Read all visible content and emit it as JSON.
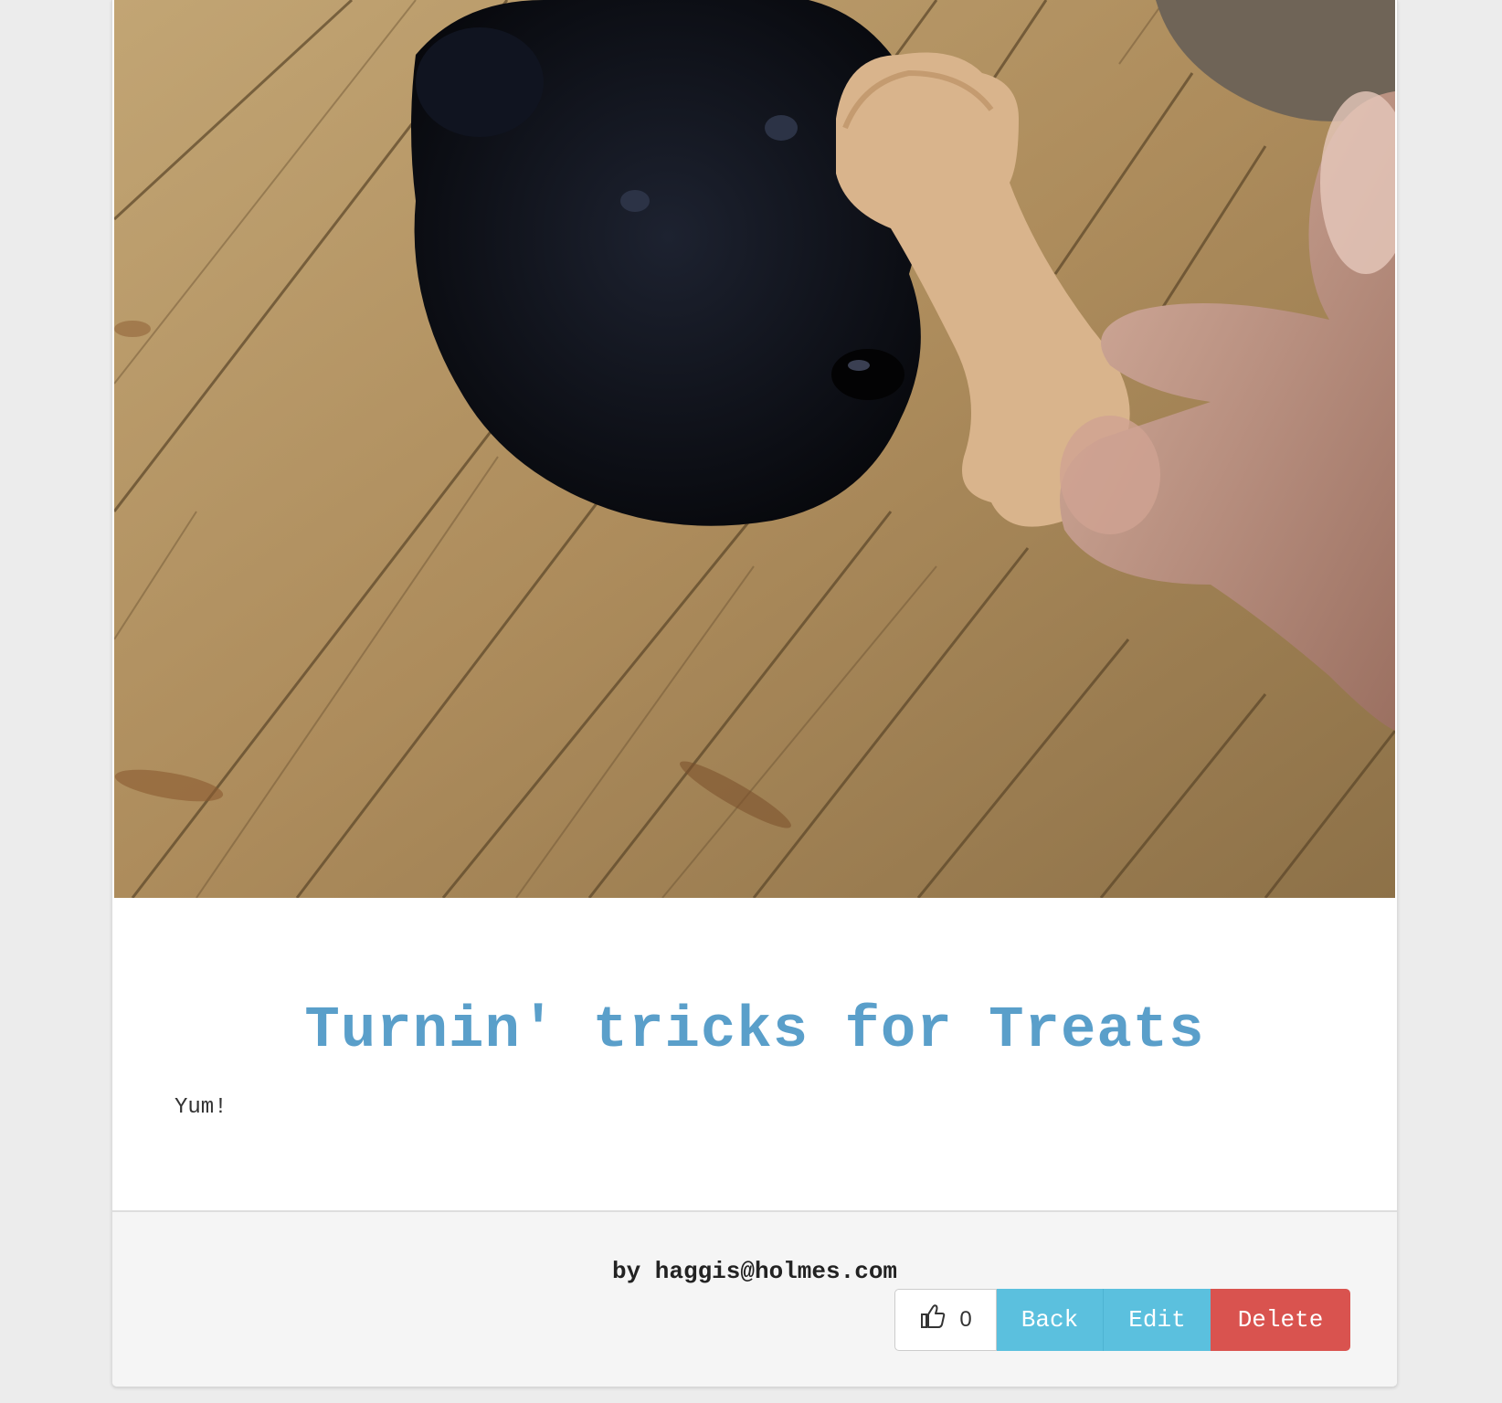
{
  "post": {
    "title": "Turnin' tricks for Treats",
    "text": "Yum!",
    "image_description": "dog-with-treat-photo"
  },
  "footer": {
    "byline": "by haggis@holmes.com",
    "like_count": "0",
    "back_label": "Back",
    "edit_label": "Edit",
    "delete_label": "Delete"
  },
  "icons": {
    "like": "thumbs-up-icon"
  },
  "colors": {
    "title": "#5a9fca",
    "info_button": "#5bc0de",
    "danger_button": "#d9534f",
    "footer_bg": "#f5f5f5",
    "page_bg": "#ececec"
  }
}
